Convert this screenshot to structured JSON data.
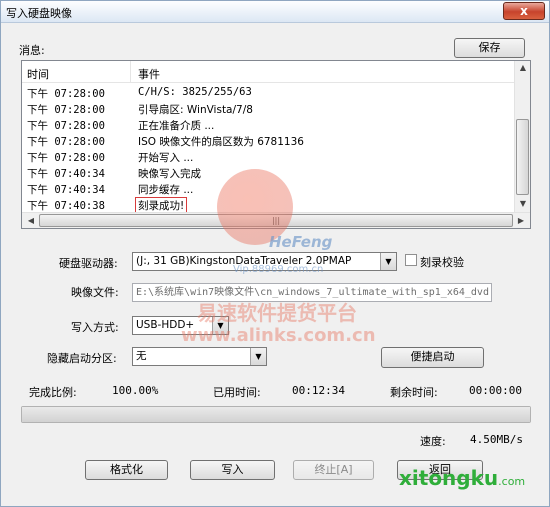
{
  "window": {
    "title": "写入硬盘映像",
    "close_label": "x"
  },
  "messages": {
    "label": "消息:",
    "save_label": "保存",
    "columns": [
      "时间",
      "事件"
    ],
    "rows": [
      {
        "time": "下午 07:28:00",
        "event": "C/H/S: 3825/255/63"
      },
      {
        "time": "下午 07:28:00",
        "event": "引导扇区: WinVista/7/8"
      },
      {
        "time": "下午 07:28:00",
        "event": "正在准备介质 ..."
      },
      {
        "time": "下午 07:28:00",
        "event": "ISO 映像文件的扇区数为 6781136"
      },
      {
        "time": "下午 07:28:00",
        "event": "开始写入 ..."
      },
      {
        "time": "下午 07:40:34",
        "event": "映像写入完成"
      },
      {
        "time": "下午 07:40:34",
        "event": "同步缓存 ..."
      },
      {
        "time": "下午 07:40:38",
        "event": "刻录成功!"
      }
    ],
    "hscroll_grip": "|||"
  },
  "form": {
    "drive_label": "硬盘驱动器:",
    "drive_value": "(J:, 31 GB)KingstonDataTraveler 2.0PMAP",
    "verify_label": "刻录校验",
    "verify_checked": false,
    "image_label": "映像文件:",
    "image_value": "E:\\系统库\\win7映像文件\\cn_windows_7_ultimate_with_sp1_x64_dvd",
    "method_label": "写入方式:",
    "method_value": "USB-HDD+",
    "hidden_label": "隐藏启动分区:",
    "hidden_value": "无",
    "quickboot_label": "便捷启动"
  },
  "status": {
    "complete_label": "完成比例:",
    "complete_value": "100.00%",
    "elapsed_label": "已用时间:",
    "elapsed_value": "00:12:34",
    "remaining_label": "剩余时间:",
    "remaining_value": "00:00:00",
    "progress": 1.0,
    "speed_label": "速度:",
    "speed_value": "4.50MB/s"
  },
  "buttons": {
    "format": "格式化",
    "write": "写入",
    "abort": "终止[A]",
    "back": "返回"
  },
  "watermarks": {
    "brand1": "HeFeng",
    "url1": "Vip.88969.com.cn",
    "cn_text": "易速软件提货平台",
    "url2": "www.alinks.com.cn",
    "brand2": "xitongku",
    "brand2_suffix": ".com"
  }
}
